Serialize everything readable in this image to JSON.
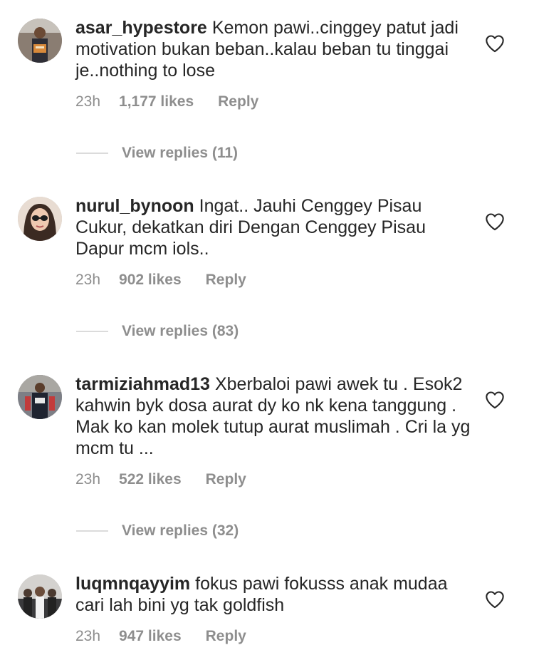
{
  "comments": [
    {
      "username": "asar_hypestore",
      "text": "Kemon pawi..cinggey patut jadi motivation bukan beban..kalau beban tu tinggai je..nothing to lose",
      "time": "23h",
      "likes": "1,177 likes",
      "reply": "Reply",
      "view_replies": "View replies (11)"
    },
    {
      "username": "nurul_bynoon",
      "text": "Ingat.. Jauhi Cenggey Pisau Cukur, dekatkan diri Dengan Cenggey Pisau Dapur mcm iols..",
      "time": "23h",
      "likes": "902 likes",
      "reply": "Reply",
      "view_replies": "View replies (83)"
    },
    {
      "username": "tarmiziahmad13",
      "text": "Xberbaloi pawi awek tu . Esok2 kahwin byk dosa aurat dy ko nk kena tanggung . Mak ko kan molek tutup aurat muslimah . Cri la yg mcm tu ...",
      "time": "23h",
      "likes": "522 likes",
      "reply": "Reply",
      "view_replies": "View replies (32)"
    },
    {
      "username": "luqmnqayyim",
      "text": "fokus pawi fokusss anak mudaa cari lah bini yg tak goldfish",
      "time": "23h",
      "likes": "947 likes",
      "reply": "Reply"
    }
  ],
  "icons": {
    "heart": "heart-icon"
  },
  "colors": {
    "text": "#262626",
    "secondary": "#8e8e8e",
    "divider": "#dbdbdb"
  }
}
